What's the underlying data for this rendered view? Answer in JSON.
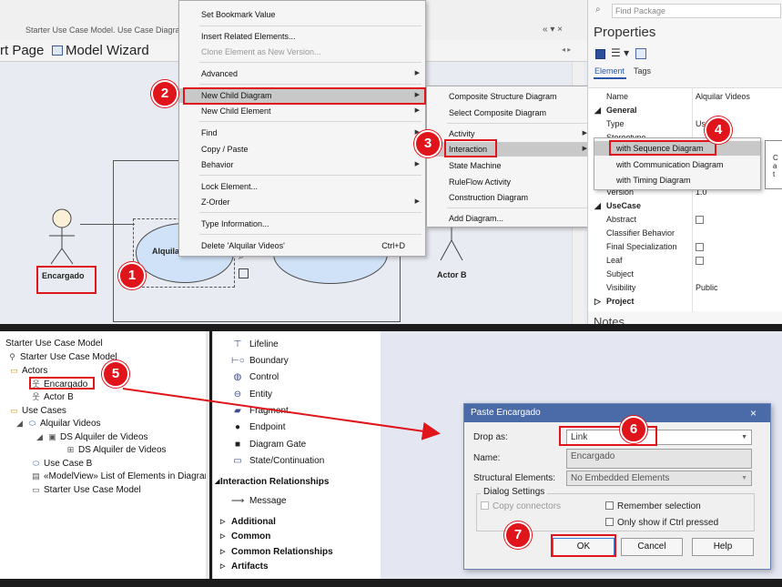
{
  "top": {
    "doc_tab": "Starter Use Case Model.  Use Case Diagram",
    "close_x": "×",
    "editor_tabs": [
      "rt Page",
      "Model Wizard"
    ]
  },
  "diagram": {
    "actor_left_label": "Encargado",
    "use_case_label": "Alquilar Videos",
    "actor_right_label": "Actor B"
  },
  "context_menu": {
    "items": [
      {
        "label": "Set Bookmark Value"
      },
      {
        "label": "Insert Related Elements..."
      },
      {
        "label": "Clone Element as New Version..."
      },
      {
        "label": "Advanced"
      },
      {
        "label": "New Child Diagram"
      },
      {
        "label": "New Child Element"
      },
      {
        "label": "Find"
      },
      {
        "label": "Copy / Paste"
      },
      {
        "label": "Behavior"
      },
      {
        "label": "Lock Element..."
      },
      {
        "label": "Z-Order"
      },
      {
        "label": "Type Information..."
      },
      {
        "label": "Delete 'Alquilar Videos'",
        "shortcut": "Ctrl+D"
      }
    ]
  },
  "submenu_child_diagram": {
    "items": [
      {
        "label": "Composite Structure Diagram"
      },
      {
        "label": "Select Composite Diagram"
      },
      {
        "label": "Activity"
      },
      {
        "label": "Interaction"
      },
      {
        "label": "State Machine"
      },
      {
        "label": "RuleFlow Activity"
      },
      {
        "label": "Construction Diagram"
      },
      {
        "label": "Add Diagram..."
      }
    ]
  },
  "submenu_interaction": {
    "items": [
      {
        "label": "with Sequence Diagram"
      },
      {
        "label": "with Communication Diagram"
      },
      {
        "label": "with Timing Diagram"
      }
    ]
  },
  "properties": {
    "find_placeholder": "Find Package",
    "title": "Properties",
    "tab_element": "Element",
    "tab_tags": "Tags",
    "rows": [
      {
        "key": "Name",
        "value": "Alquilar Videos"
      },
      {
        "key": "General",
        "value": ""
      },
      {
        "key": "Type",
        "value": "Us"
      },
      {
        "key": "Stereotype",
        "value": ""
      },
      {
        "key": "Version",
        "value": "1.0"
      },
      {
        "key": "UseCase",
        "value": ""
      },
      {
        "key": "Abstract",
        "value": ""
      },
      {
        "key": "Classifier Behavior",
        "value": ""
      },
      {
        "key": "Final Specialization",
        "value": ""
      },
      {
        "key": "Leaf",
        "value": ""
      },
      {
        "key": "Subject",
        "value": ""
      },
      {
        "key": "Visibility",
        "value": "Public"
      },
      {
        "key": "Project",
        "value": ""
      }
    ],
    "notes_label": "Notes",
    "tooltip_chars": "C\na\nt"
  },
  "tree": {
    "items": [
      {
        "label": "Starter Use Case Model"
      },
      {
        "label": "Starter Use Case Model"
      },
      {
        "label": "Actors"
      },
      {
        "label": "Encargado"
      },
      {
        "label": "Actor B"
      },
      {
        "label": "Use Cases"
      },
      {
        "label": "Alquilar Videos"
      },
      {
        "label": "DS Alquiler de Videos"
      },
      {
        "label": "DS Alquiler de Videos"
      },
      {
        "label": "Use Case B"
      },
      {
        "label": "«ModelView» List of Elements in Diagram"
      },
      {
        "label": "Starter Use Case Model"
      }
    ]
  },
  "toolbox": {
    "tools": [
      "Lifeline",
      "Boundary",
      "Control",
      "Entity",
      "Fragment",
      "Endpoint",
      "Diagram Gate",
      "State/Continuation"
    ],
    "section_interaction": "Interaction Relationships",
    "message": "Message",
    "groups": [
      "Additional",
      "Common",
      "Common Relationships",
      "Artifacts"
    ]
  },
  "dialog": {
    "title": "Paste Encargado",
    "close": "×",
    "drop_as_label": "Drop as:",
    "drop_as_value": "Link",
    "name_label": "Name:",
    "name_value": "Encargado",
    "structural_label": "Structural Elements:",
    "structural_value": "No Embedded Elements",
    "settings_legend": "Dialog Settings",
    "copy_connectors": "Copy connectors",
    "remember_selection": "Remember selection",
    "only_ctrl": "Only show if Ctrl pressed",
    "ok": "OK",
    "cancel": "Cancel",
    "help": "Help"
  },
  "badges": [
    "1",
    "2",
    "3",
    "4",
    "5",
    "6",
    "7"
  ],
  "colors": {
    "highlight_red": "#e0151b",
    "dialog_title": "#4a6aa8"
  }
}
